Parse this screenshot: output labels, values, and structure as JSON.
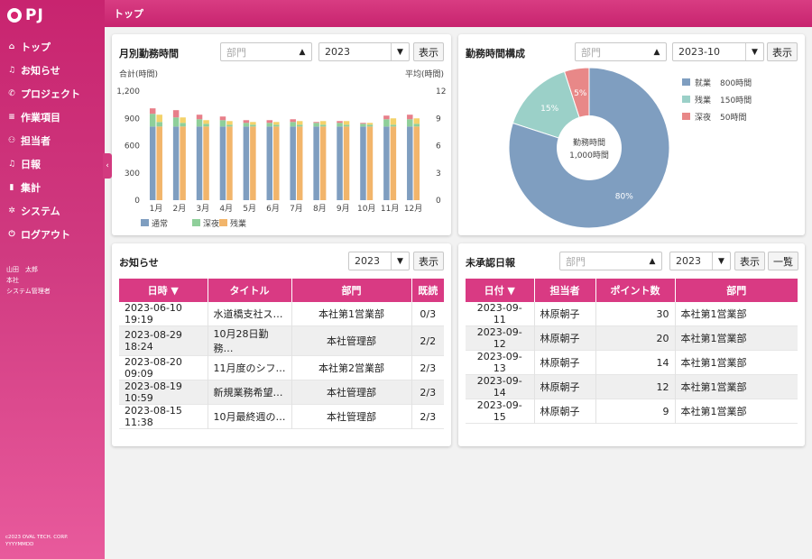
{
  "sidebar": {
    "logo": "PJ",
    "items": [
      {
        "label": "トップ",
        "icon": "⌂",
        "name": "top"
      },
      {
        "label": "お知らせ",
        "icon": "♫",
        "name": "notice"
      },
      {
        "label": "プロジェクト",
        "icon": "✆",
        "name": "project"
      },
      {
        "label": "作業項目",
        "icon": "≡",
        "name": "work-items"
      },
      {
        "label": "担当者",
        "icon": "⚇",
        "name": "staff"
      },
      {
        "label": "日報",
        "icon": "♫",
        "name": "daily-report"
      },
      {
        "label": "集計",
        "icon": "▮",
        "name": "summary"
      },
      {
        "label": "システム",
        "icon": "✲",
        "name": "system"
      },
      {
        "label": "ログアウト",
        "icon": "⏻",
        "name": "logout"
      }
    ],
    "user_name": "山田　太郎",
    "user_dept": "本社",
    "user_role": "システム管理者",
    "copyright_line1": "c2023 OVAL TECH. CORP.",
    "copyright_line2": "YYYYMMDD",
    "collapse_icon": "‹"
  },
  "header": {
    "title": "トップ"
  },
  "monthly": {
    "title": "月別勤務時間",
    "dept_placeholder": "部門",
    "year": "2023",
    "show_button": "表示",
    "left_axis_label": "合計(時間)",
    "right_axis_label": "平均(時間)"
  },
  "composition": {
    "title": "勤務時間構成",
    "dept_placeholder": "部門",
    "month": "2023-10",
    "show_button": "表示"
  },
  "notice": {
    "title": "お知らせ",
    "year": "2023",
    "show_button": "表示",
    "columns": [
      "日時 ▼",
      "タイトル",
      "部門",
      "既読"
    ],
    "rows": [
      [
        "2023-06-10 19:19",
        "水道橋支社ス…",
        "本社第1営業部",
        "0/3"
      ],
      [
        "2023-08-29 18:24",
        "10月28日勤務…",
        "本社管理部",
        "2/2"
      ],
      [
        "2023-08-20 09:09",
        "11月度のシフ…",
        "本社第2営業部",
        "2/3"
      ],
      [
        "2023-08-19 10:59",
        "新規業務希望…",
        "本社管理部",
        "2/3"
      ],
      [
        "2023-08-15 11:38",
        "10月最終週の…",
        "本社管理部",
        "2/3"
      ]
    ]
  },
  "unapproved": {
    "title": "未承認日報",
    "dept_placeholder": "部門",
    "year": "2023",
    "show_button": "表示",
    "list_button": "一覧",
    "columns": [
      "日付 ▼",
      "担当者",
      "ポイント数",
      "部門"
    ],
    "rows": [
      [
        "2023-09-11",
        "林原朝子",
        "30",
        "本社第1営業部"
      ],
      [
        "2023-09-12",
        "林原朝子",
        "20",
        "本社第1営業部"
      ],
      [
        "2023-09-13",
        "林原朝子",
        "14",
        "本社第1営業部"
      ],
      [
        "2023-09-14",
        "林原朝子",
        "12",
        "本社第1営業部"
      ],
      [
        "2023-09-15",
        "林原朝子",
        "9",
        "本社第1営業部"
      ]
    ]
  },
  "colors": {
    "accent": "#d93a83",
    "regular": "#7f9ec0",
    "overtime": "#f2b56b",
    "night": "#8fcf9a",
    "overtime_top": "#e87f8a",
    "extra_top": "#f4d26a",
    "pie_regular": "#7f9ec0",
    "pie_overtime": "#9bd0c8",
    "pie_night": "#e88888"
  },
  "chart_data": [
    {
      "type": "bar",
      "categories": [
        "1月",
        "2月",
        "3月",
        "4月",
        "5月",
        "6月",
        "7月",
        "8月",
        "9月",
        "10月",
        "11月",
        "12月"
      ],
      "series": [
        {
          "name": "通常",
          "values": [
            810,
            810,
            810,
            810,
            810,
            810,
            810,
            810,
            810,
            810,
            810,
            810
          ]
        },
        {
          "name": "深夜",
          "values": [
            140,
            100,
            80,
            70,
            40,
            40,
            50,
            40,
            40,
            30,
            80,
            80
          ]
        },
        {
          "name": "残業",
          "values": [
            60,
            80,
            50,
            40,
            30,
            30,
            30,
            10,
            20,
            10,
            40,
            50
          ]
        }
      ],
      "stacks_right": [
        {
          "name": "通常",
          "values": [
            810,
            810,
            810,
            810,
            810,
            810,
            810,
            810,
            810,
            810,
            810,
            810
          ]
        },
        {
          "name": "残業",
          "values": [
            50,
            40,
            30,
            20,
            20,
            20,
            20,
            20,
            20,
            20,
            20,
            30
          ]
        },
        {
          "name": "top",
          "values": [
            80,
            60,
            40,
            40,
            30,
            30,
            40,
            40,
            40,
            20,
            70,
            60
          ]
        }
      ],
      "legend": [
        "通常",
        "深夜",
        "残業"
      ],
      "ylabel": "合計(時間)",
      "y2label": "平均(時間)",
      "ylim": [
        0,
        1200
      ],
      "y2lim": [
        0,
        12
      ],
      "yticks": [
        "0",
        "300",
        "600",
        "900",
        "1,200"
      ],
      "y2ticks": [
        "0",
        "3",
        "6",
        "9",
        "12"
      ]
    },
    {
      "type": "pie",
      "labels": [
        "就業",
        "残業",
        "深夜"
      ],
      "values": [
        800,
        150,
        50
      ],
      "legend_values": [
        "800時間",
        "150時間",
        "50時間"
      ],
      "slice_labels": [
        "80%",
        "15%",
        "5%"
      ],
      "center_line1": "勤務時間",
      "center_line2": "1,000時間"
    }
  ]
}
